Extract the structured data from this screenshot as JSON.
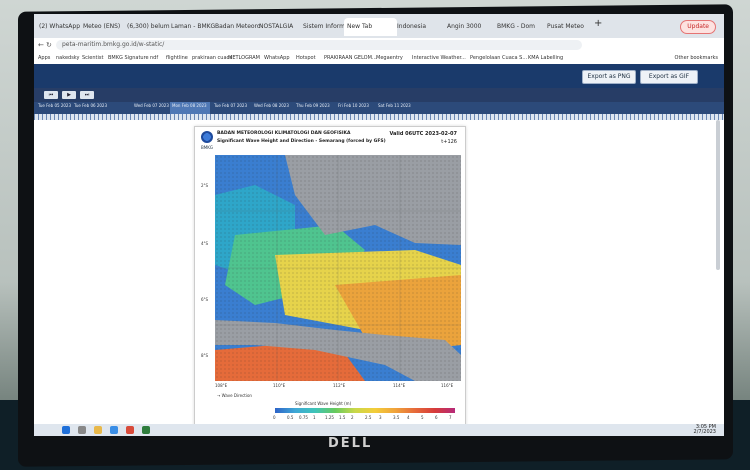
{
  "browser": {
    "tabs": [
      {
        "label": "(2) WhatsApp"
      },
      {
        "label": "Meteo (ENS)"
      },
      {
        "label": "(6,300) belum"
      },
      {
        "label": "Laman - BMKG"
      },
      {
        "label": "Badan Meteoro"
      },
      {
        "label": "NOSTALGIA"
      },
      {
        "label": "Sistem Inform"
      },
      {
        "label": "New Tab"
      },
      {
        "label": "Indonesia"
      },
      {
        "label": "Angin 3000"
      },
      {
        "label": "BMKG - Dom"
      },
      {
        "label": "Pusat Meteo"
      }
    ],
    "new_tab": "+",
    "update_label": "Update",
    "url": "peta-maritim.bmkg.go.id/w-static/"
  },
  "bookmarks": {
    "items": [
      "Apps",
      "nakedsky",
      "Scientist",
      "BMKG Signature",
      "ndf",
      "flightline",
      "prakiraan cuaca",
      "METLOGRAM",
      "WhatsApp",
      "Hotspot",
      "PRAKIRAAN GELOM...",
      "Megaentry",
      "Interactive Weather...",
      "Pengelolaan Cuaca S...",
      "KMA Labelling"
    ],
    "other": "Other bookmarks"
  },
  "toolbar": {
    "export_png": "Export as PNG",
    "export_gif": "Export as GIF"
  },
  "timeline": {
    "dates": [
      "Tue Feb 05 2023",
      "Tue Feb 06 2023",
      "Wed Feb 07 2023",
      "Mon Feb 08 2023",
      "Tue Feb 07 2023",
      "Wed Feb 08 2023",
      "Thu Feb 09 2023",
      "Fri Feb 10 2023",
      "Sat Feb 11 2023"
    ]
  },
  "map_card": {
    "agency": "BADAN METEOROLOGI KLIMATOLOGI DAN GEOFISIKA",
    "title": "Significant Wave Height and Direction - Semarang (forced by GFS)",
    "valid": "Valid 06UTC 2023-02-07",
    "lead": "t+126",
    "logo_text": "BMKG",
    "lat_labels": [
      "2°S",
      "4°S",
      "6°S",
      "8°S"
    ],
    "lon_labels": [
      "108°E",
      "110°E",
      "112°E",
      "114°E",
      "116°E"
    ],
    "legend_note": "→ Wave Direction",
    "colorbar_title": "Significant Wave Height (m)",
    "colorbar_values": [
      "0",
      "0.5",
      "0.75",
      "1",
      "1.25",
      "1.5",
      "2",
      "2.5",
      "3",
      "3.5",
      "4",
      "5",
      "6",
      "7"
    ]
  },
  "taskbar": {
    "time": "3:05 PM",
    "date": "2/7/2023"
  },
  "monitor": {
    "brand": "DELL"
  }
}
